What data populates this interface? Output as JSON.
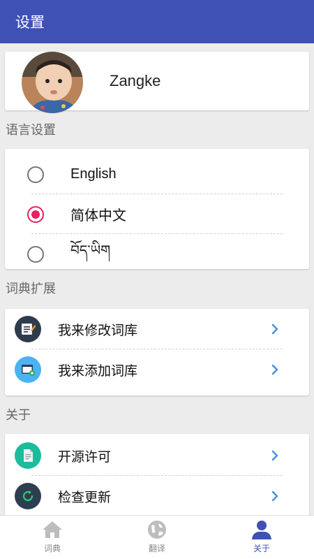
{
  "appbar": {
    "title": "设置"
  },
  "profile": {
    "username": "Zangke"
  },
  "language_section": {
    "title": "语言设置",
    "options": [
      {
        "label": "English",
        "selected": false
      },
      {
        "label": "简体中文",
        "selected": true
      },
      {
        "label": "བོད་ཡིག",
        "selected": false
      }
    ]
  },
  "dict_section": {
    "title": "词典扩展",
    "items": [
      {
        "label": "我来修改词库",
        "icon": "edit-document-icon",
        "icon_bg": "#2f3b4d"
      },
      {
        "label": "我来添加词库",
        "icon": "window-add-icon",
        "icon_bg": "#4ab3f4"
      }
    ]
  },
  "about_section": {
    "title": "关于",
    "items": [
      {
        "label": "开源许可",
        "icon": "license-document-icon",
        "icon_bg": "#1abc9c"
      },
      {
        "label": "检查更新",
        "icon": "refresh-icon",
        "icon_bg": "#2c3e50"
      }
    ]
  },
  "bottom_nav": {
    "items": [
      {
        "label": "词典",
        "icon": "home-icon",
        "active": false
      },
      {
        "label": "翻译",
        "icon": "globe-icon",
        "active": false
      },
      {
        "label": "关于",
        "icon": "person-icon",
        "active": true
      }
    ]
  },
  "colors": {
    "primary": "#3f51b5",
    "accent": "#e91e63",
    "chevron": "#4a90e2"
  }
}
